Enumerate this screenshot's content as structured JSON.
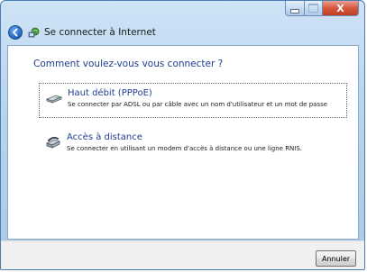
{
  "window": {
    "title": "Se connecter à Internet"
  },
  "main": {
    "question": "Comment voulez-vous vous connecter ?",
    "options": [
      {
        "title": "Haut débit (PPPoE)",
        "description": "Se connecter par ADSL ou par câble avec un nom d'utilisateur et un mot de passe",
        "icon": "broadband-modem-icon"
      },
      {
        "title": "Accès à distance",
        "description": "Se connecter en utilisant un modem d'accès à distance ou une ligne RNIS.",
        "icon": "dialup-modem-icon"
      }
    ]
  },
  "footer": {
    "cancel_label": "Annuler"
  },
  "caption": {
    "close_label": "X"
  },
  "colors": {
    "heading_blue": "#1e3d8f",
    "frame_blue": "#a9c9e8",
    "close_red": "#c23e22"
  }
}
